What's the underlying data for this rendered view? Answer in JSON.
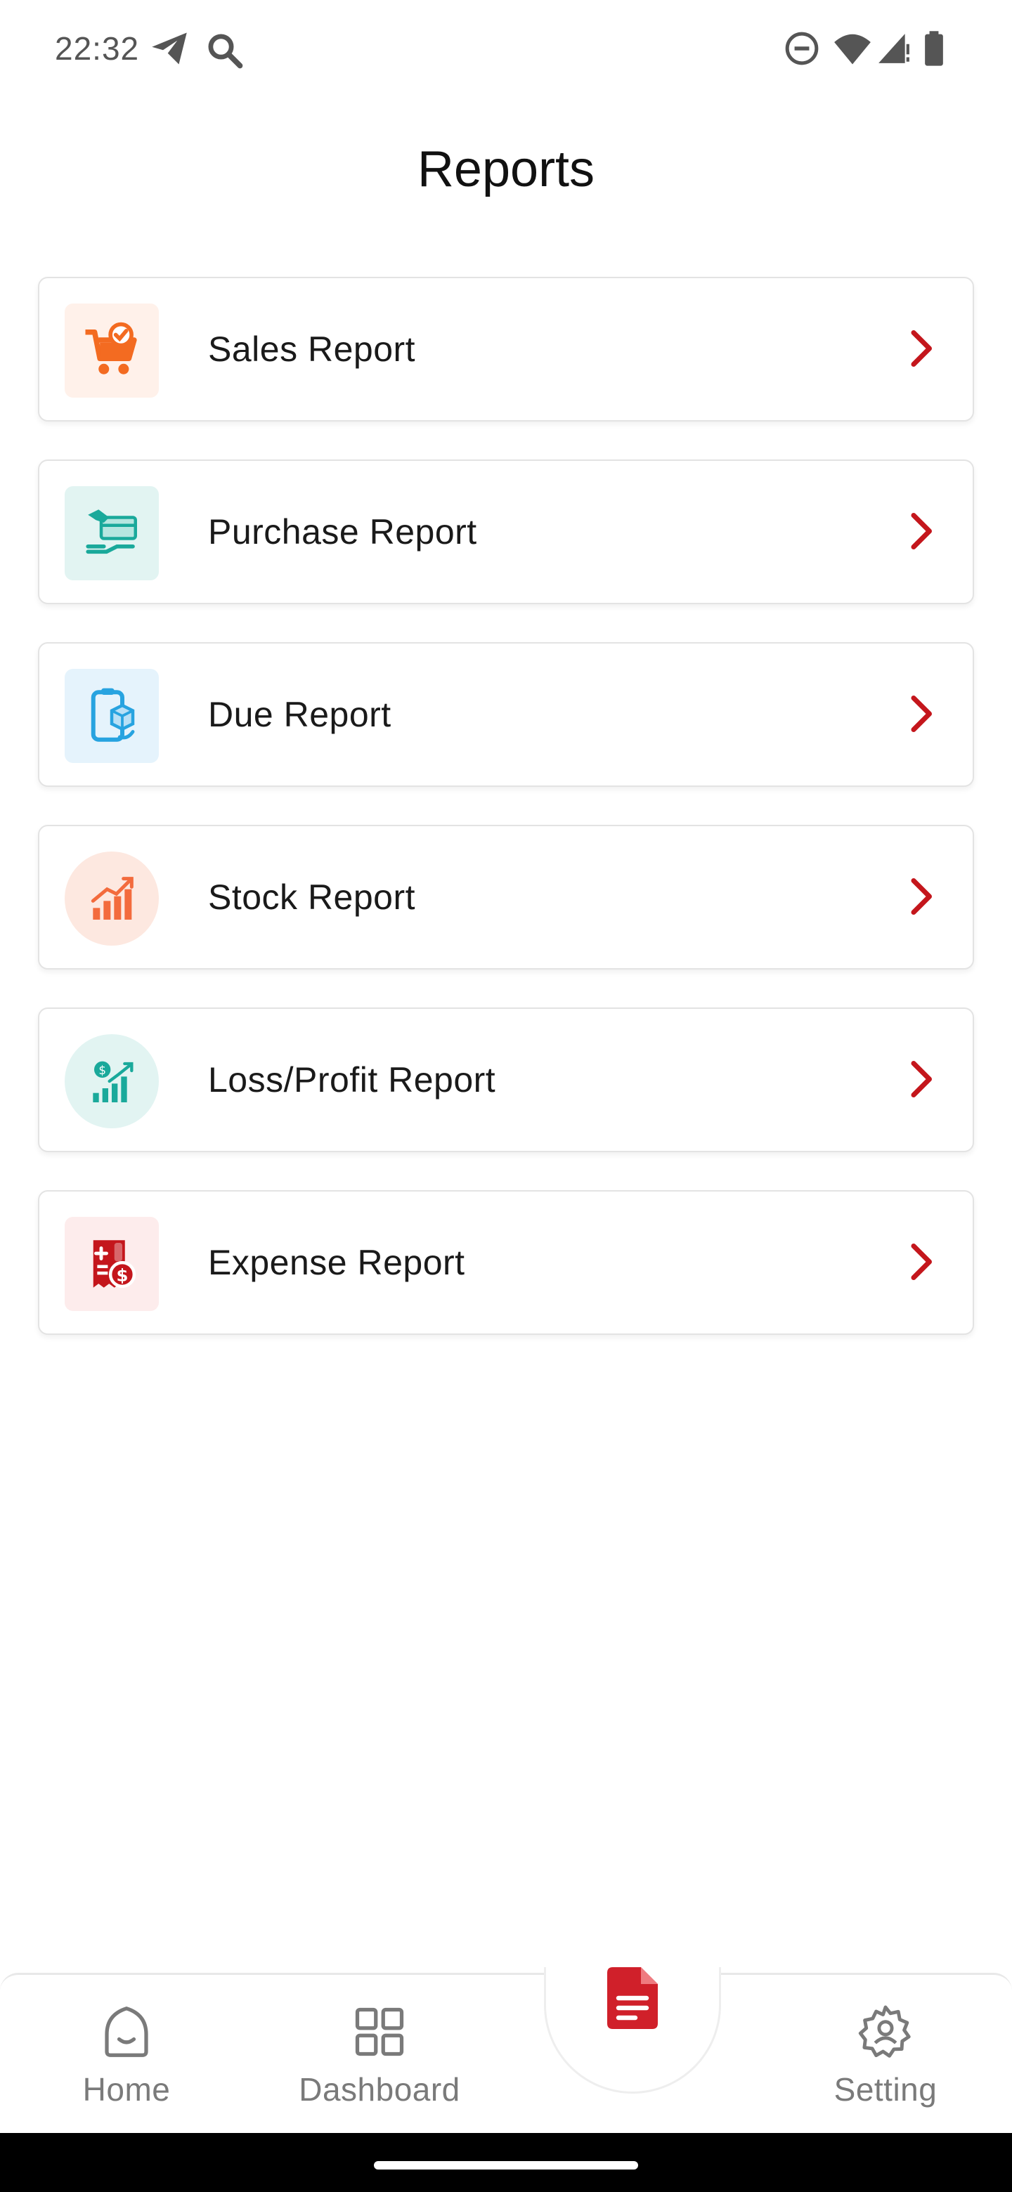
{
  "status_bar": {
    "time": "22:32",
    "icons": [
      "telegram-icon",
      "search-icon",
      "dnd-icon",
      "wifi-icon",
      "signal-icon",
      "battery-icon"
    ]
  },
  "header": {
    "title": "Reports"
  },
  "reports": [
    {
      "label": "Sales Report",
      "icon": "cart-icon",
      "icon_bg": "#fff1ea",
      "icon_color": "#f36b21"
    },
    {
      "label": "Purchase Report",
      "icon": "card-payment-icon",
      "icon_bg": "#e2f4f2",
      "icon_color": "#1aa99b"
    },
    {
      "label": "Due Report",
      "icon": "phone-box-icon",
      "icon_bg": "#e5f3fc",
      "icon_color": "#27a3e0"
    },
    {
      "label": "Stock Report",
      "icon": "growth-chart-icon",
      "icon_bg": "#fde8e0",
      "icon_color": "#f36b3d"
    },
    {
      "label": "Loss/Profit Report",
      "icon": "profit-chart-icon",
      "icon_bg": "#e2f4f2",
      "icon_color": "#1aa99b"
    },
    {
      "label": "Expense Report",
      "icon": "expense-calculator-icon",
      "icon_bg": "#fdecec",
      "icon_color": "#c4161c"
    }
  ],
  "bottom_nav": {
    "items": [
      {
        "label": "Home",
        "icon": "home-face-icon"
      },
      {
        "label": "Dashboard",
        "icon": "grid-icon"
      },
      {
        "label": "Setting",
        "icon": "gear-icon"
      }
    ],
    "center_action": {
      "icon": "report-document-icon",
      "color": "#d0202a"
    }
  },
  "colors": {
    "accent": "#c4161c",
    "nav_inactive": "#7a7a7a"
  }
}
